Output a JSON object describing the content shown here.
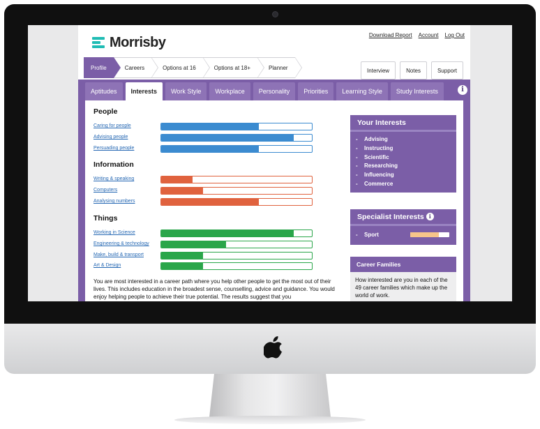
{
  "brand": {
    "name": "Morrisby",
    "accent": "#1fbcb4"
  },
  "top_links": [
    "Download Report",
    "Account",
    "Log Out"
  ],
  "steps": [
    {
      "label": "Profile",
      "active": true
    },
    {
      "label": "Careers"
    },
    {
      "label": "Options at 16"
    },
    {
      "label": "Options at 18+"
    },
    {
      "label": "Planner"
    }
  ],
  "util_buttons": [
    "Interview",
    "Notes",
    "Support"
  ],
  "tabs": [
    {
      "label": "Aptitudes"
    },
    {
      "label": "Interests",
      "active": true
    },
    {
      "label": "Work Style"
    },
    {
      "label": "Workplace"
    },
    {
      "label": "Personality"
    },
    {
      "label": "Priorities"
    },
    {
      "label": "Learning Style"
    },
    {
      "label": "Study Interests"
    }
  ],
  "colors": {
    "theme": "#7b5ea7",
    "people": "#3b8bd0",
    "information": "#e0623e",
    "things": "#2aa64a",
    "specialist": "#f7c58a"
  },
  "groups": [
    {
      "title": "People",
      "color": "people",
      "items": [
        {
          "label": "Caring for people",
          "level": 0.65
        },
        {
          "label": "Advising people",
          "level": 0.88
        },
        {
          "label": "Persuading people",
          "level": 0.65
        }
      ]
    },
    {
      "title": "Information",
      "color": "information",
      "items": [
        {
          "label": "Writing & speaking",
          "level": 0.21
        },
        {
          "label": "Computers",
          "level": 0.28
        },
        {
          "label": "Analysing numbers",
          "level": 0.65
        }
      ]
    },
    {
      "title": "Things",
      "color": "things",
      "items": [
        {
          "label": "Working in Science",
          "level": 0.88
        },
        {
          "label": "Engineering & technology",
          "level": 0.43
        },
        {
          "label": "Make, build & transport",
          "level": 0.28
        },
        {
          "label": "Art & Design",
          "level": 0.28
        }
      ]
    }
  ],
  "summary": "You are most interested in a career path where you help other people to get the most out of their lives. This includes education in the broadest sense, counselling, advice and guidance. You would enjoy helping people to achieve their true potential. The results suggest that you",
  "your_interests": {
    "title": "Your Interests",
    "items": [
      "Advising",
      "Instructing",
      "Scientific",
      "Researching",
      "Influencing",
      "Commerce"
    ]
  },
  "specialist": {
    "title": "Specialist Interests",
    "items": [
      {
        "label": "Sport",
        "level": 0.73
      }
    ]
  },
  "career_families": {
    "title": "Career Families",
    "text": "How interested are you in each of the 49 career families which make up the world of work."
  }
}
